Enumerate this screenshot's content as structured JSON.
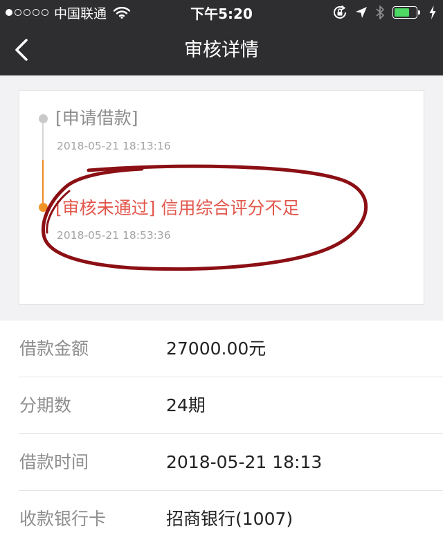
{
  "status_bar": {
    "carrier": "中国联通",
    "time": "下午5:20",
    "battery_level_percent": 70,
    "battery_color": "#4cd964",
    "icons": [
      "signal-dots-icon",
      "wifi-icon",
      "orientation-lock-icon",
      "location-arrow-icon",
      "bluetooth-icon",
      "battery-icon",
      "charging-bolt-icon"
    ]
  },
  "nav": {
    "title": "审核详情",
    "back_icon": "chevron-left-icon"
  },
  "timeline": {
    "entries": [
      {
        "title": "[申请借款]",
        "time": "2018-05-21 18:13:16",
        "status_color": "#c9c9c9",
        "text_color": "#8c8c8c"
      },
      {
        "title": "[审核未通过] 信用综合评分不足",
        "time": "2018-05-21 18:53:36",
        "status_color": "#f29426",
        "text_color": "#e2574c"
      }
    ],
    "annotation": "hand-drawn-red-circle"
  },
  "details": {
    "rows": [
      {
        "label": "借款金额",
        "value": "27000.00元"
      },
      {
        "label": "分期数",
        "value": "24期"
      },
      {
        "label": "借款时间",
        "value": "2018-05-21 18:13"
      },
      {
        "label": "收款银行卡",
        "value": "招商银行(1007)"
      }
    ]
  },
  "colors": {
    "header_bg": "#2e2e30",
    "page_bg": "#f2f2f4",
    "rejected_text": "#e2574c",
    "annotation_ink": "#8b0f14"
  }
}
